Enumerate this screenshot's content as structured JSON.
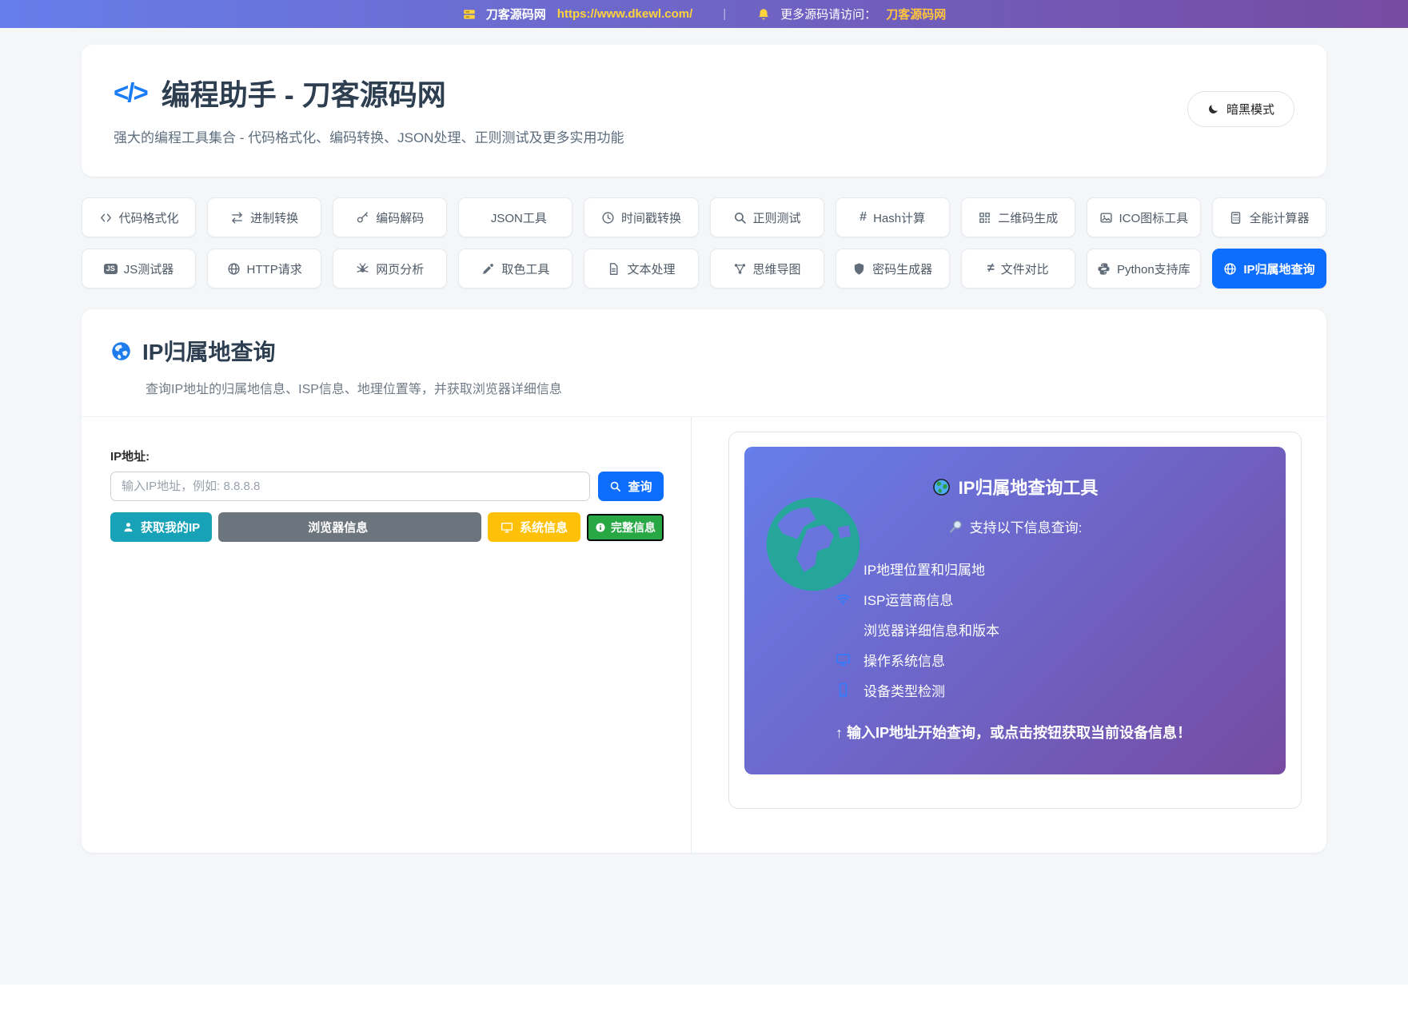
{
  "topbar": {
    "site_name": "刀客源码网",
    "site_url": "https://www.dkewl.com/",
    "divider": "|",
    "more_label": "更多源码请访问：",
    "more_link": "刀客源码网"
  },
  "header": {
    "title": "编程助手 - 刀客源码网",
    "subtitle": "强大的编程工具集合 - 代码格式化、编码转换、JSON处理、正则测试及更多实用功能",
    "dark_mode_label": "暗黑模式"
  },
  "toolbar": {
    "tools": [
      {
        "icon": "code",
        "label": "代码格式化"
      },
      {
        "icon": "swap-arrows",
        "label": "进制转换"
      },
      {
        "icon": "key",
        "label": "编码解码"
      },
      {
        "icon": "none",
        "label": "JSON工具"
      },
      {
        "icon": "clock",
        "label": "时间戳转换"
      },
      {
        "icon": "search",
        "label": "正则测试"
      },
      {
        "icon": "hash",
        "label": "Hash计算"
      },
      {
        "icon": "qrcode",
        "label": "二维码生成"
      },
      {
        "icon": "image",
        "label": "ICO图标工具"
      },
      {
        "icon": "calculator",
        "label": "全能计算器"
      },
      {
        "icon": "js-badge",
        "label": "JS测试器"
      },
      {
        "icon": "globe",
        "label": "HTTP请求"
      },
      {
        "icon": "spider",
        "label": "网页分析"
      },
      {
        "icon": "eyedropper",
        "label": "取色工具"
      },
      {
        "icon": "file-text",
        "label": "文本处理"
      },
      {
        "icon": "mindmap",
        "label": "思维导图"
      },
      {
        "icon": "shield",
        "label": "密码生成器"
      },
      {
        "icon": "not-equal",
        "label": "文件对比"
      },
      {
        "icon": "python",
        "label": "Python支持库"
      },
      {
        "icon": "globe",
        "label": "IP归属地查询",
        "active": true
      }
    ]
  },
  "ip_tool": {
    "title": "IP归属地查询",
    "description": "查询IP地址的归属地信息、ISP信息、地理位置等，并获取浏览器详细信息",
    "form": {
      "ip_label": "IP地址:",
      "ip_placeholder": "输入IP地址，例如: 8.8.8.8",
      "query_button": "查询",
      "my_ip_button": "获取我的IP",
      "browser_button": "浏览器信息",
      "system_button": "系统信息",
      "full_info_button": "完整信息"
    },
    "panel": {
      "title": "IP归属地查询工具",
      "subtitle": "支持以下信息查询:",
      "features": [
        {
          "icon": "location-pin",
          "label": "IP地理位置和归属地"
        },
        {
          "icon": "wifi",
          "label": "ISP运营商信息"
        },
        {
          "icon": "blank",
          "label": "浏览器详细信息和版本"
        },
        {
          "icon": "monitor",
          "label": "操作系统信息"
        },
        {
          "icon": "mobile",
          "label": "设备类型检测"
        }
      ],
      "note": "↑ 输入IP地址开始查询，或点击按钮获取当前设备信息！"
    }
  },
  "colors": {
    "gradient_start": "#667eea",
    "gradient_end": "#764ba2",
    "accent_blue": "#0d6efd",
    "teal": "#17a2b8",
    "gray": "#6c757d",
    "yellow": "#ffc107",
    "green": "#28a745",
    "globe_teal": "#26a69a",
    "link_gold": "#ffd43b"
  }
}
